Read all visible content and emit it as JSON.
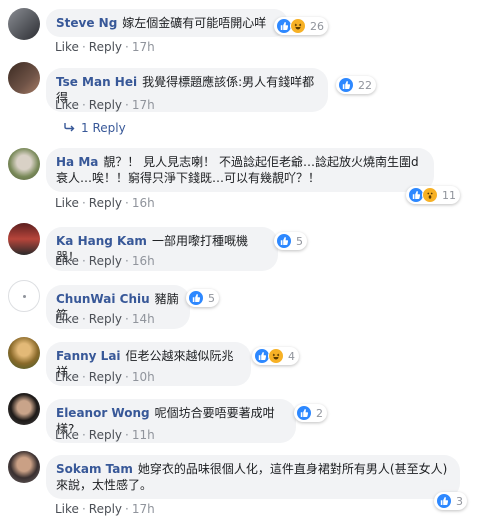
{
  "actions": {
    "like": "Like",
    "reply": "Reply",
    "dot": "·"
  },
  "replies_link": "1 Reply",
  "comments": [
    {
      "author": "Steve Ng",
      "text": "嫁左個金礦有可能唔開心咩",
      "reactions": [
        "like",
        "haha"
      ],
      "count": "26",
      "time": "17h"
    },
    {
      "author": "Tse Man Hei",
      "text": "我覺得標題應該係:男人有錢咩都得",
      "reactions": [
        "like"
      ],
      "count": "22",
      "time": "17h"
    },
    {
      "author": "Ha Ma",
      "text": "靚？！ 見人見志喇！ 不過諗起佢老爺…諗起放火燒南生圍d衰人…唉！！窮得只淨下錢既…可以有幾靚吖？！",
      "reactions": [
        "like",
        "wow"
      ],
      "count": "11",
      "time": "16h"
    },
    {
      "author": "Ka Hang Kam",
      "text": "一部用嚟打種嘅機器！",
      "reactions": [
        "like"
      ],
      "count": "5",
      "time": "16h"
    },
    {
      "author": "ChunWai Chiu",
      "text": "豬腩筋",
      "reactions": [
        "like"
      ],
      "count": "5",
      "time": "14h"
    },
    {
      "author": "Fanny Lai",
      "text": "佢老公越來越似阮兆祥",
      "reactions": [
        "like",
        "haha"
      ],
      "count": "4",
      "time": "10h"
    },
    {
      "author": "Eleanor Wong",
      "text": "呢個坊合要唔要著成咁樣?",
      "reactions": [
        "like"
      ],
      "count": "2",
      "time": "11h"
    },
    {
      "author": "Sokam Tam",
      "text": "她穿衣的品味很個人化，這件直身裙對所有男人(甚至女人)來說，太性感了。",
      "reactions": [
        "like"
      ],
      "count": "3",
      "time": "17h"
    }
  ]
}
